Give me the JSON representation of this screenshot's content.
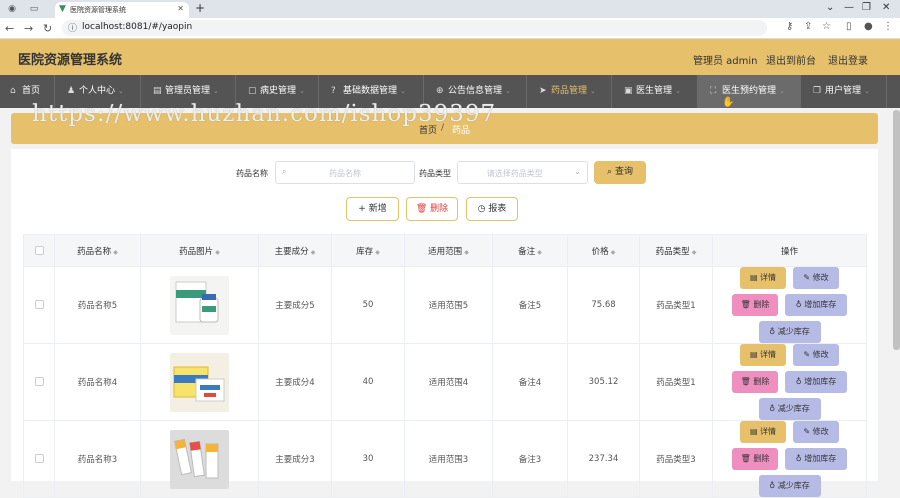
{
  "browser": {
    "tab_title": "医院资源管理系统",
    "url": "localhost:8081/#/yaopin"
  },
  "header": {
    "title": "医院资源管理系统",
    "admin_label": "管理员 admin",
    "front_link": "退出到前台",
    "logout_link": "退出登录"
  },
  "menu": {
    "items": [
      {
        "label": "首页",
        "icon": "home-icon"
      },
      {
        "label": "个人中心",
        "icon": "user-icon"
      },
      {
        "label": "管理员管理",
        "icon": "admin-icon"
      },
      {
        "label": "病史管理",
        "icon": "history-icon"
      },
      {
        "label": "基础数据管理",
        "icon": "data-icon"
      },
      {
        "label": "公告信息管理",
        "icon": "notice-icon"
      },
      {
        "label": "药品管理",
        "icon": "drug-icon"
      },
      {
        "label": "医生管理",
        "icon": "doctor-icon"
      },
      {
        "label": "医生预约管理",
        "icon": "appointment-icon"
      },
      {
        "label": "用户管理",
        "icon": "users-icon"
      }
    ]
  },
  "watermark": "https://www.huzhan.com/ishop39397",
  "breadcrumb": {
    "home": "首页",
    "separator": "/",
    "current": "药品"
  },
  "search": {
    "name_label": "药品名称",
    "name_placeholder": "药品名称",
    "type_label": "药品类型",
    "type_placeholder": "请选择药品类型",
    "query_button": "查询"
  },
  "actions": {
    "add": "新增",
    "delete": "删除",
    "report": "报表"
  },
  "table": {
    "headers": [
      "药品名称",
      "药品图片",
      "主要成分",
      "库存",
      "适用范围",
      "备注",
      "价格",
      "药品类型",
      "操作"
    ],
    "rows": [
      {
        "name": "药品名称5",
        "ingredient": "主要成分5",
        "stock": "50",
        "scope": "适用范围5",
        "note": "备注5",
        "price": "75.68",
        "type": "药品类型1"
      },
      {
        "name": "药品名称4",
        "ingredient": "主要成分4",
        "stock": "40",
        "scope": "适用范围4",
        "note": "备注4",
        "price": "305.12",
        "type": "药品类型1"
      },
      {
        "name": "药品名称3",
        "ingredient": "主要成分3",
        "stock": "30",
        "scope": "适用范围3",
        "note": "备注3",
        "price": "237.34",
        "type": "药品类型3"
      }
    ],
    "row_actions": {
      "detail": "详情",
      "edit": "修改",
      "remove": "删除",
      "increase": "增加库存",
      "decrease": "减少库存"
    }
  },
  "colors": {
    "accent": "#e6c06b",
    "menu_bg": "#545454",
    "edit_btn": "#b6bbe6",
    "delete_btn": "#ef8fc0"
  }
}
